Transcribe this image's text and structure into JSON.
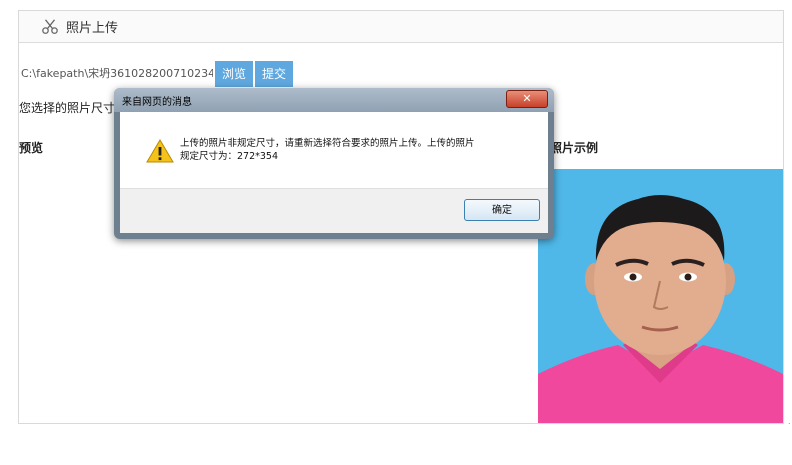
{
  "header": {
    "title": "照片上传",
    "icon": "scissors-icon"
  },
  "upload": {
    "file_path": "C:\\fakepath\\宋坍361028200710234",
    "browse_label": "浏览",
    "submit_label": "提交"
  },
  "main": {
    "size_text": "您选择的照片尺寸",
    "preview_label": "预览",
    "sample_label": "照片示例"
  },
  "dialog": {
    "title": "来自网页的消息",
    "close_label": "✕",
    "message_line1": "上传的照片非规定尺寸，请重新选择符合要求的照片上传。上传的照片",
    "message_line2": "规定尺寸为：272*354",
    "ok_label": "确定",
    "icon": "warning-icon"
  },
  "colors": {
    "accent_blue": "#5fa8df",
    "sample_bg": "#4fb8e8",
    "shirt": "#f0489c"
  }
}
